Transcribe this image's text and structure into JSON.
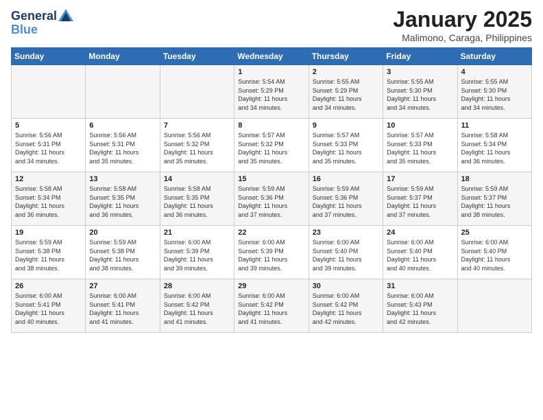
{
  "header": {
    "logo_line1": "General",
    "logo_line2": "Blue",
    "month_title": "January 2025",
    "location": "Malimono, Caraga, Philippines"
  },
  "weekdays": [
    "Sunday",
    "Monday",
    "Tuesday",
    "Wednesday",
    "Thursday",
    "Friday",
    "Saturday"
  ],
  "weeks": [
    [
      {
        "day": "",
        "info": ""
      },
      {
        "day": "",
        "info": ""
      },
      {
        "day": "",
        "info": ""
      },
      {
        "day": "1",
        "info": "Sunrise: 5:54 AM\nSunset: 5:29 PM\nDaylight: 11 hours\nand 34 minutes."
      },
      {
        "day": "2",
        "info": "Sunrise: 5:55 AM\nSunset: 5:29 PM\nDaylight: 11 hours\nand 34 minutes."
      },
      {
        "day": "3",
        "info": "Sunrise: 5:55 AM\nSunset: 5:30 PM\nDaylight: 11 hours\nand 34 minutes."
      },
      {
        "day": "4",
        "info": "Sunrise: 5:55 AM\nSunset: 5:30 PM\nDaylight: 11 hours\nand 34 minutes."
      }
    ],
    [
      {
        "day": "5",
        "info": "Sunrise: 5:56 AM\nSunset: 5:31 PM\nDaylight: 11 hours\nand 34 minutes."
      },
      {
        "day": "6",
        "info": "Sunrise: 5:56 AM\nSunset: 5:31 PM\nDaylight: 11 hours\nand 35 minutes."
      },
      {
        "day": "7",
        "info": "Sunrise: 5:56 AM\nSunset: 5:32 PM\nDaylight: 11 hours\nand 35 minutes."
      },
      {
        "day": "8",
        "info": "Sunrise: 5:57 AM\nSunset: 5:32 PM\nDaylight: 11 hours\nand 35 minutes."
      },
      {
        "day": "9",
        "info": "Sunrise: 5:57 AM\nSunset: 5:33 PM\nDaylight: 11 hours\nand 35 minutes."
      },
      {
        "day": "10",
        "info": "Sunrise: 5:57 AM\nSunset: 5:33 PM\nDaylight: 11 hours\nand 35 minutes."
      },
      {
        "day": "11",
        "info": "Sunrise: 5:58 AM\nSunset: 5:34 PM\nDaylight: 11 hours\nand 36 minutes."
      }
    ],
    [
      {
        "day": "12",
        "info": "Sunrise: 5:58 AM\nSunset: 5:34 PM\nDaylight: 11 hours\nand 36 minutes."
      },
      {
        "day": "13",
        "info": "Sunrise: 5:58 AM\nSunset: 5:35 PM\nDaylight: 11 hours\nand 36 minutes."
      },
      {
        "day": "14",
        "info": "Sunrise: 5:58 AM\nSunset: 5:35 PM\nDaylight: 11 hours\nand 36 minutes."
      },
      {
        "day": "15",
        "info": "Sunrise: 5:59 AM\nSunset: 5:36 PM\nDaylight: 11 hours\nand 37 minutes."
      },
      {
        "day": "16",
        "info": "Sunrise: 5:59 AM\nSunset: 5:36 PM\nDaylight: 11 hours\nand 37 minutes."
      },
      {
        "day": "17",
        "info": "Sunrise: 5:59 AM\nSunset: 5:37 PM\nDaylight: 11 hours\nand 37 minutes."
      },
      {
        "day": "18",
        "info": "Sunrise: 5:59 AM\nSunset: 5:37 PM\nDaylight: 11 hours\nand 38 minutes."
      }
    ],
    [
      {
        "day": "19",
        "info": "Sunrise: 5:59 AM\nSunset: 5:38 PM\nDaylight: 11 hours\nand 38 minutes."
      },
      {
        "day": "20",
        "info": "Sunrise: 5:59 AM\nSunset: 5:38 PM\nDaylight: 11 hours\nand 38 minutes."
      },
      {
        "day": "21",
        "info": "Sunrise: 6:00 AM\nSunset: 5:39 PM\nDaylight: 11 hours\nand 39 minutes."
      },
      {
        "day": "22",
        "info": "Sunrise: 6:00 AM\nSunset: 5:39 PM\nDaylight: 11 hours\nand 39 minutes."
      },
      {
        "day": "23",
        "info": "Sunrise: 6:00 AM\nSunset: 5:40 PM\nDaylight: 11 hours\nand 39 minutes."
      },
      {
        "day": "24",
        "info": "Sunrise: 6:00 AM\nSunset: 5:40 PM\nDaylight: 11 hours\nand 40 minutes."
      },
      {
        "day": "25",
        "info": "Sunrise: 6:00 AM\nSunset: 5:40 PM\nDaylight: 11 hours\nand 40 minutes."
      }
    ],
    [
      {
        "day": "26",
        "info": "Sunrise: 6:00 AM\nSunset: 5:41 PM\nDaylight: 11 hours\nand 40 minutes."
      },
      {
        "day": "27",
        "info": "Sunrise: 6:00 AM\nSunset: 5:41 PM\nDaylight: 11 hours\nand 41 minutes."
      },
      {
        "day": "28",
        "info": "Sunrise: 6:00 AM\nSunset: 5:42 PM\nDaylight: 11 hours\nand 41 minutes."
      },
      {
        "day": "29",
        "info": "Sunrise: 6:00 AM\nSunset: 5:42 PM\nDaylight: 11 hours\nand 41 minutes."
      },
      {
        "day": "30",
        "info": "Sunrise: 6:00 AM\nSunset: 5:42 PM\nDaylight: 11 hours\nand 42 minutes."
      },
      {
        "day": "31",
        "info": "Sunrise: 6:00 AM\nSunset: 5:43 PM\nDaylight: 11 hours\nand 42 minutes."
      },
      {
        "day": "",
        "info": ""
      }
    ]
  ]
}
